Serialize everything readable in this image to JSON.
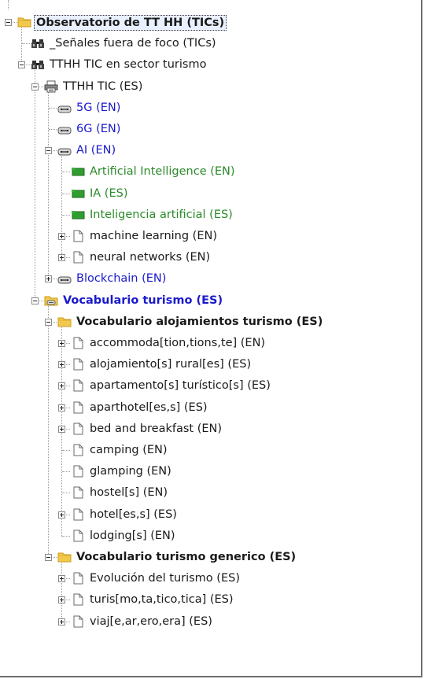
{
  "tree": [
    {
      "id": "n0",
      "level": 0,
      "expander": "minus",
      "icon": "folder-icon",
      "label": "Observatorio de TT HH (TICs)",
      "style": "bold selected"
    },
    {
      "id": "n1",
      "level": 1,
      "expander": "none",
      "icon": "binoculars-icon",
      "label": "_Señales fuera de foco (TICs)",
      "style": ""
    },
    {
      "id": "n2",
      "level": 1,
      "expander": "minus",
      "icon": "binoculars-icon",
      "label": "TTHH TIC en sector turismo",
      "style": ""
    },
    {
      "id": "n3",
      "level": 2,
      "expander": "minus",
      "icon": "printer-icon",
      "label": "TTHH TIC (ES)",
      "style": ""
    },
    {
      "id": "n4",
      "level": 3,
      "expander": "none",
      "icon": "link-icon",
      "label": "5G (EN)",
      "style": "blue"
    },
    {
      "id": "n5",
      "level": 3,
      "expander": "none",
      "icon": "link-icon",
      "label": "6G (EN)",
      "style": "blue"
    },
    {
      "id": "n6",
      "level": 3,
      "expander": "minus",
      "icon": "link-icon",
      "label": "AI (EN)",
      "style": "blue"
    },
    {
      "id": "n7",
      "level": 4,
      "expander": "none",
      "icon": "green-tag-icon",
      "label": "Artificial Intelligence (EN)",
      "style": "green"
    },
    {
      "id": "n8",
      "level": 4,
      "expander": "none",
      "icon": "green-tag-icon",
      "label": "IA (ES)",
      "style": "green"
    },
    {
      "id": "n9",
      "level": 4,
      "expander": "none",
      "icon": "green-tag-icon",
      "label": "Inteligencia artificial (ES)",
      "style": "green"
    },
    {
      "id": "n10",
      "level": 4,
      "expander": "plus",
      "icon": "document-icon",
      "label": "machine learning (EN)",
      "style": ""
    },
    {
      "id": "n11",
      "level": 4,
      "expander": "plus",
      "icon": "document-icon",
      "label": "neural networks (EN)",
      "style": ""
    },
    {
      "id": "n12",
      "level": 3,
      "expander": "plus",
      "icon": "link-icon",
      "label": "Blockchain (EN)",
      "style": "blue"
    },
    {
      "id": "n13",
      "level": 2,
      "expander": "minus",
      "icon": "folder-link-icon",
      "label": "Vocabulario turismo (ES)",
      "style": "blue bold"
    },
    {
      "id": "n14",
      "level": 3,
      "expander": "minus",
      "icon": "folder-icon",
      "label": "Vocabulario alojamientos turismo (ES)",
      "style": "bold"
    },
    {
      "id": "n15",
      "level": 4,
      "expander": "plus",
      "icon": "document-icon",
      "label": "accommoda[tion,tions,te] (EN)",
      "style": ""
    },
    {
      "id": "n16",
      "level": 4,
      "expander": "plus",
      "icon": "document-icon",
      "label": "alojamiento[s] rural[es] (ES)",
      "style": ""
    },
    {
      "id": "n17",
      "level": 4,
      "expander": "plus",
      "icon": "document-icon",
      "label": "apartamento[s] turístico[s] (ES)",
      "style": ""
    },
    {
      "id": "n18",
      "level": 4,
      "expander": "plus",
      "icon": "document-icon",
      "label": "aparthotel[es,s] (ES)",
      "style": ""
    },
    {
      "id": "n19",
      "level": 4,
      "expander": "plus",
      "icon": "document-icon",
      "label": "bed and breakfast (EN)",
      "style": ""
    },
    {
      "id": "n20",
      "level": 4,
      "expander": "none",
      "icon": "document-icon",
      "label": "camping (EN)",
      "style": ""
    },
    {
      "id": "n21",
      "level": 4,
      "expander": "none",
      "icon": "document-icon",
      "label": "glamping (EN)",
      "style": ""
    },
    {
      "id": "n22",
      "level": 4,
      "expander": "none",
      "icon": "document-icon",
      "label": "hostel[s] (EN)",
      "style": ""
    },
    {
      "id": "n23",
      "level": 4,
      "expander": "plus",
      "icon": "document-icon",
      "label": "hotel[es,s] (ES)",
      "style": ""
    },
    {
      "id": "n24",
      "level": 4,
      "expander": "none",
      "icon": "document-icon",
      "label": "lodging[s] (EN)",
      "style": ""
    },
    {
      "id": "n25",
      "level": 3,
      "expander": "minus",
      "icon": "folder-icon",
      "label": "Vocabulario turismo generico (ES)",
      "style": "bold"
    },
    {
      "id": "n26",
      "level": 4,
      "expander": "plus",
      "icon": "document-icon",
      "label": "Evolución del turismo (ES)",
      "style": ""
    },
    {
      "id": "n27",
      "level": 4,
      "expander": "plus",
      "icon": "document-icon",
      "label": "turis[mo,ta,tico,tica] (ES)",
      "style": ""
    },
    {
      "id": "n28",
      "level": 4,
      "expander": "plus",
      "icon": "document-icon",
      "label": "viaj[e,ar,ero,era] (ES)",
      "style": ""
    }
  ],
  "colors": {
    "link": "#1a1acc",
    "synonym": "#2b8a2b",
    "folder": "#f2c94c",
    "frame": "#6e6e6e"
  }
}
